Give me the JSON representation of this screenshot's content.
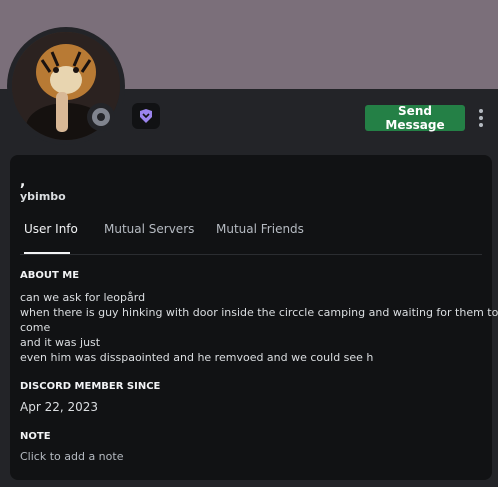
{
  "profile": {
    "display_name": ",",
    "username": "ybimbo",
    "send_message_label": "Send Message"
  },
  "tabs": [
    {
      "label": "User Info"
    },
    {
      "label": "Mutual Servers"
    },
    {
      "label": "Mutual Friends"
    }
  ],
  "about": {
    "title": "ABOUT ME",
    "lines": [
      "can we ask for leopård",
      "when there is guy hinking with door inside the circcle camping and waiting for them to",
      "come",
      "and it was just",
      "even him was disspaointed and he remvoed and we could see h"
    ]
  },
  "member_since": {
    "title": "DISCORD MEMBER SINCE",
    "date": "Apr 22, 2023"
  },
  "note": {
    "title": "NOTE",
    "placeholder": "Click to add a note"
  },
  "icons": {
    "badge": "hypesquad-badge-icon",
    "more": "more-options-icon",
    "status": "offline-status-icon"
  },
  "colors": {
    "banner": "#7b6f7a",
    "send_button": "#248046",
    "badge": "#9b84ee"
  }
}
